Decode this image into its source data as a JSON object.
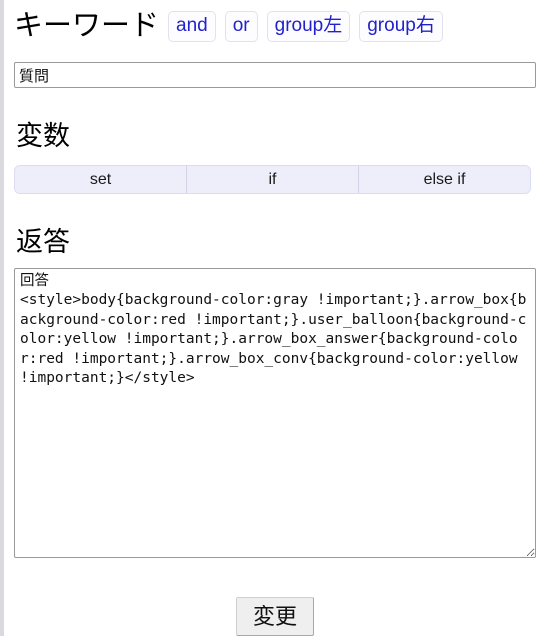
{
  "keyword_section": {
    "heading": "キーワード",
    "buttons": [
      {
        "label": "and",
        "name": "and"
      },
      {
        "label": "or",
        "name": "or"
      },
      {
        "label": "group左",
        "name": "group-left"
      },
      {
        "label": "group右",
        "name": "group-right"
      }
    ]
  },
  "question_input": {
    "value": "質問",
    "placeholder": ""
  },
  "variable_section": {
    "heading": "変数",
    "buttons": [
      {
        "label": "set"
      },
      {
        "label": "if"
      },
      {
        "label": "else if"
      }
    ]
  },
  "answer_section": {
    "heading": "返答",
    "textarea_value": "回答\n<style>body{background-color:gray !important;}.arrow_box{background-color:red !important;}.user_balloon{background-color:yellow !important;}.arrow_box_answer{background-color:red !important;}.arrow_box_conv{background-color:yellow !important;}</style>",
    "textarea_placeholder": ""
  },
  "submit": {
    "label": "変更"
  },
  "colors": {
    "button_text_blue": "#2222cc",
    "segment_background": "#eeeefa",
    "input_border": "#9a9a9a",
    "submit_background": "#efefef"
  }
}
